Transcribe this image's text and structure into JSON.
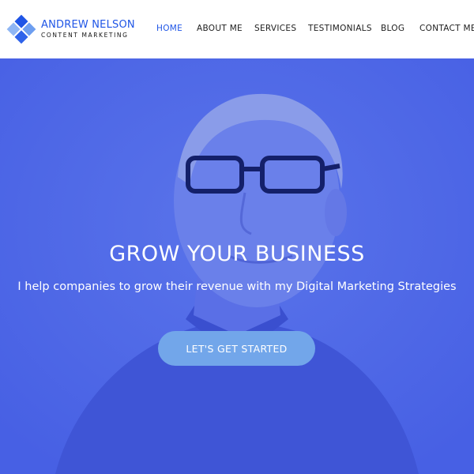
{
  "brand": {
    "name": "ANDREW NELSON",
    "tagline": "CONTENT MARKETING",
    "accent": "#1f55e6"
  },
  "nav": {
    "items": [
      {
        "label": "HOME",
        "active": true
      },
      {
        "label": "ABOUT ME",
        "active": false
      },
      {
        "label": "SERVICES",
        "active": false
      },
      {
        "label": "TESTIMONIALS",
        "active": false
      },
      {
        "label": "BLOG",
        "active": false
      },
      {
        "label": "CONTACT ME",
        "active": false
      }
    ]
  },
  "hero": {
    "title": "GROW YOUR BUSINESS",
    "subtitle": "I help companies to grow their revenue with my Digital Marketing Strategies",
    "cta_label": "LET'S GET STARTED",
    "overlay_color": "#4b66e6",
    "cta_color": "#72a6ea"
  }
}
